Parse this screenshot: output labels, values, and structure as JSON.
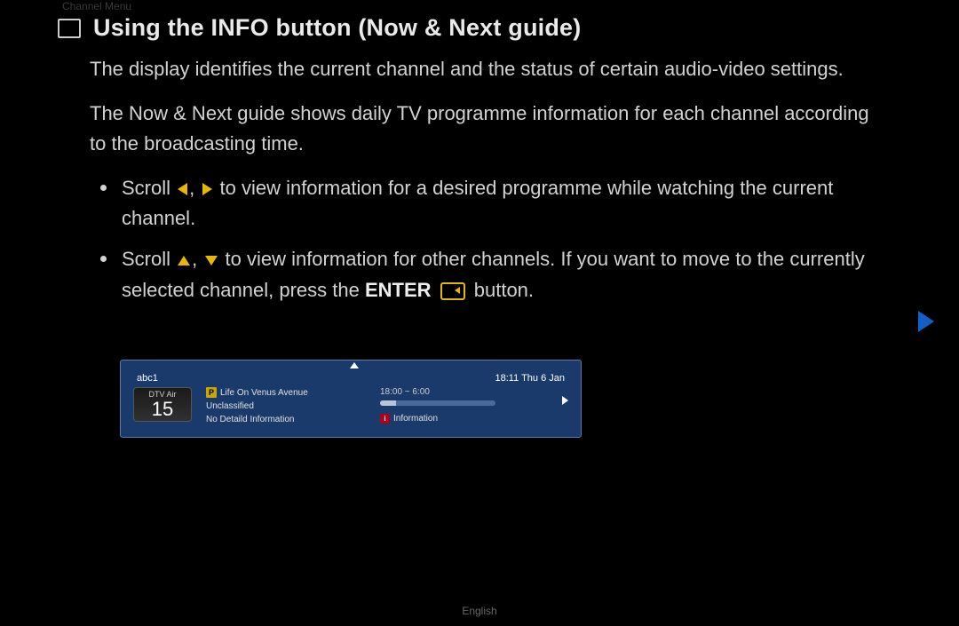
{
  "breadcrumb": "Channel Menu",
  "title": "Using the INFO button (Now & Next guide)",
  "para1": "The display identifies the current channel and the status of certain audio-video settings.",
  "para2": "The Now & Next guide shows daily TV programme information for each channel according to the broadcasting time.",
  "bullets": {
    "b1_pre": "Scroll ",
    "b1_post": " to view information for a desired programme while watching the current channel.",
    "b2_pre": "Scroll ",
    "b2_mid": " to view information for other channels. If you want to move to the currently selected channel, press the ",
    "b2_enter": "ENTER",
    "b2_post": " button."
  },
  "info_panel": {
    "channel_name": "abc1",
    "clock": "18:11 Thu 6 Jan",
    "source": "DTV Air",
    "channel_number": "15",
    "programme_badge": "P",
    "programme_title": "Life On Venus Avenue",
    "classification": "Unclassified",
    "detail": "No Detaild Information",
    "time_range": "18:00 ~ 6:00",
    "info_badge": "i",
    "info_label": "Information"
  },
  "footer": {
    "language": "English"
  }
}
